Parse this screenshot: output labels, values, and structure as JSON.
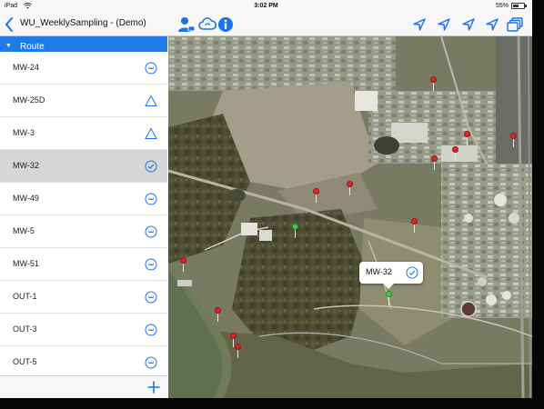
{
  "status_bar": {
    "carrier": "iPad",
    "time": "3:02 PM",
    "battery": "55%",
    "battery_level": 0.55
  },
  "nav": {
    "title": "WU_WeeklySampling - (Demo)",
    "back_icon": "chevron-left-icon",
    "toolbar_icons": [
      "user-assign-icon",
      "cloud-sync-icon",
      "info-icon",
      "location-arrow-icon",
      "location-arrow-icon",
      "location-arrow-icon",
      "location-arrow-icon",
      "layers-icon"
    ]
  },
  "panel": {
    "header": "Route",
    "items": [
      {
        "label": "MW-24",
        "status": "pending-circle-icon"
      },
      {
        "label": "MW-25D",
        "status": "warning-triangle-icon"
      },
      {
        "label": "MW-3",
        "status": "warning-triangle-icon"
      },
      {
        "label": "MW-32",
        "status": "check-circle-icon",
        "selected": true
      },
      {
        "label": "MW-49",
        "status": "pending-circle-icon"
      },
      {
        "label": "MW-5",
        "status": "pending-circle-icon"
      },
      {
        "label": "MW-51",
        "status": "pending-circle-icon"
      },
      {
        "label": "OUT-1",
        "status": "pending-circle-icon"
      },
      {
        "label": "OUT-3",
        "status": "pending-circle-icon"
      },
      {
        "label": "OUT-5",
        "status": "pending-circle-icon"
      }
    ],
    "add_icon": "plus-icon"
  },
  "map": {
    "callout_label": "MW-32",
    "callout_icon": "check-circle-icon",
    "colors": {
      "accent": "#1e7be6",
      "pin_red": "#e02424",
      "pin_green": "#3fcf3f"
    }
  }
}
